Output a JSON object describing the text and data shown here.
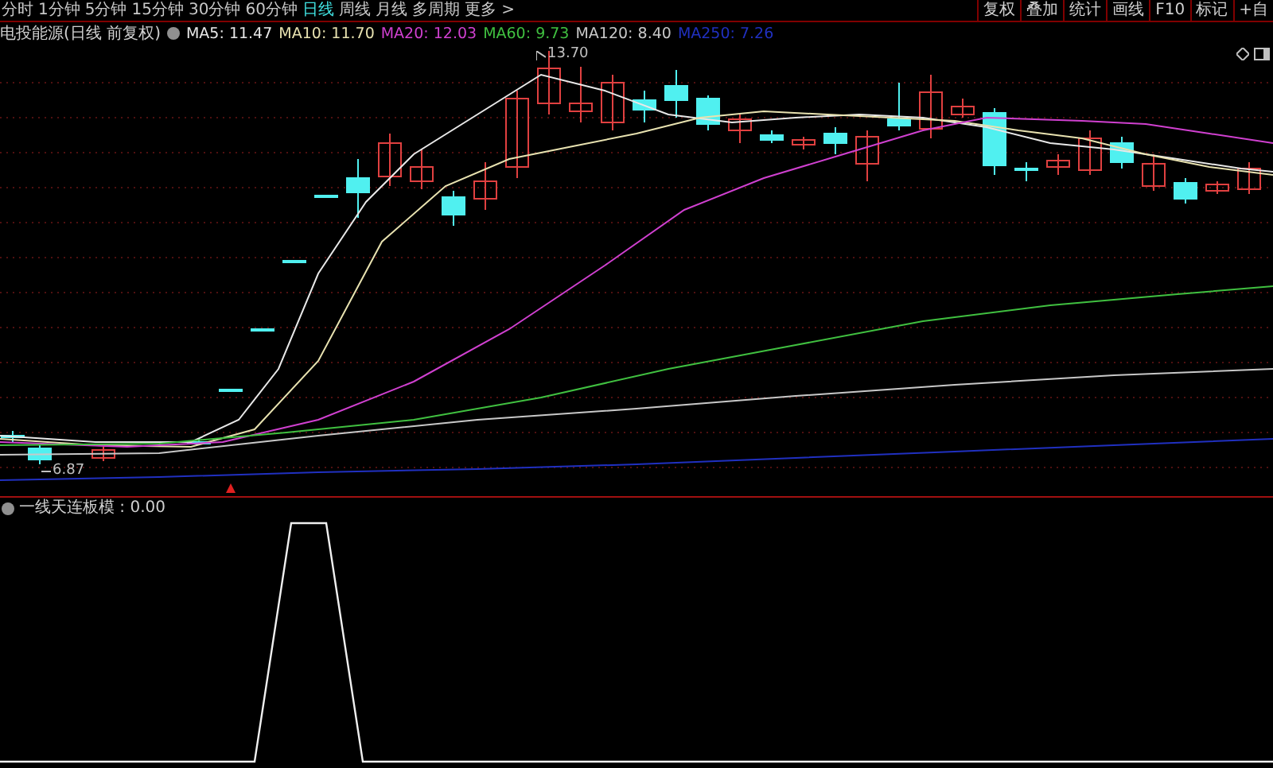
{
  "toolbar": {
    "periods": [
      {
        "label": "分时",
        "selected": false
      },
      {
        "label": "1分钟",
        "selected": false
      },
      {
        "label": "5分钟",
        "selected": false
      },
      {
        "label": "15分钟",
        "selected": false
      },
      {
        "label": "30分钟",
        "selected": false
      },
      {
        "label": "60分钟",
        "selected": false
      },
      {
        "label": "日线",
        "selected": true
      },
      {
        "label": "周线",
        "selected": false
      },
      {
        "label": "月线",
        "selected": false
      },
      {
        "label": "多周期",
        "selected": false
      },
      {
        "label": "更多 >",
        "selected": false
      }
    ],
    "actions": [
      "复权",
      "叠加",
      "统计",
      "画线",
      "F10",
      "标记",
      "+自"
    ]
  },
  "legend": {
    "title": "电投能源(日线 前复权)",
    "averages": [
      {
        "label": "MA5: 11.47",
        "color": "#e8e8e8"
      },
      {
        "label": "MA10: 11.70",
        "color": "#e8e2b0"
      },
      {
        "label": "MA20: 12.03",
        "color": "#d040d0"
      },
      {
        "label": "MA60: 9.73",
        "color": "#40c040"
      },
      {
        "label": "MA120: 8.40",
        "color": "#c8c8c8"
      },
      {
        "label": "MA250: 7.26",
        "color": "#2030c0"
      }
    ]
  },
  "chart": {
    "high_label": "13.70",
    "low_label": "6.87"
  },
  "indicator": {
    "label": "一线天连板模 : 0.00"
  }
}
